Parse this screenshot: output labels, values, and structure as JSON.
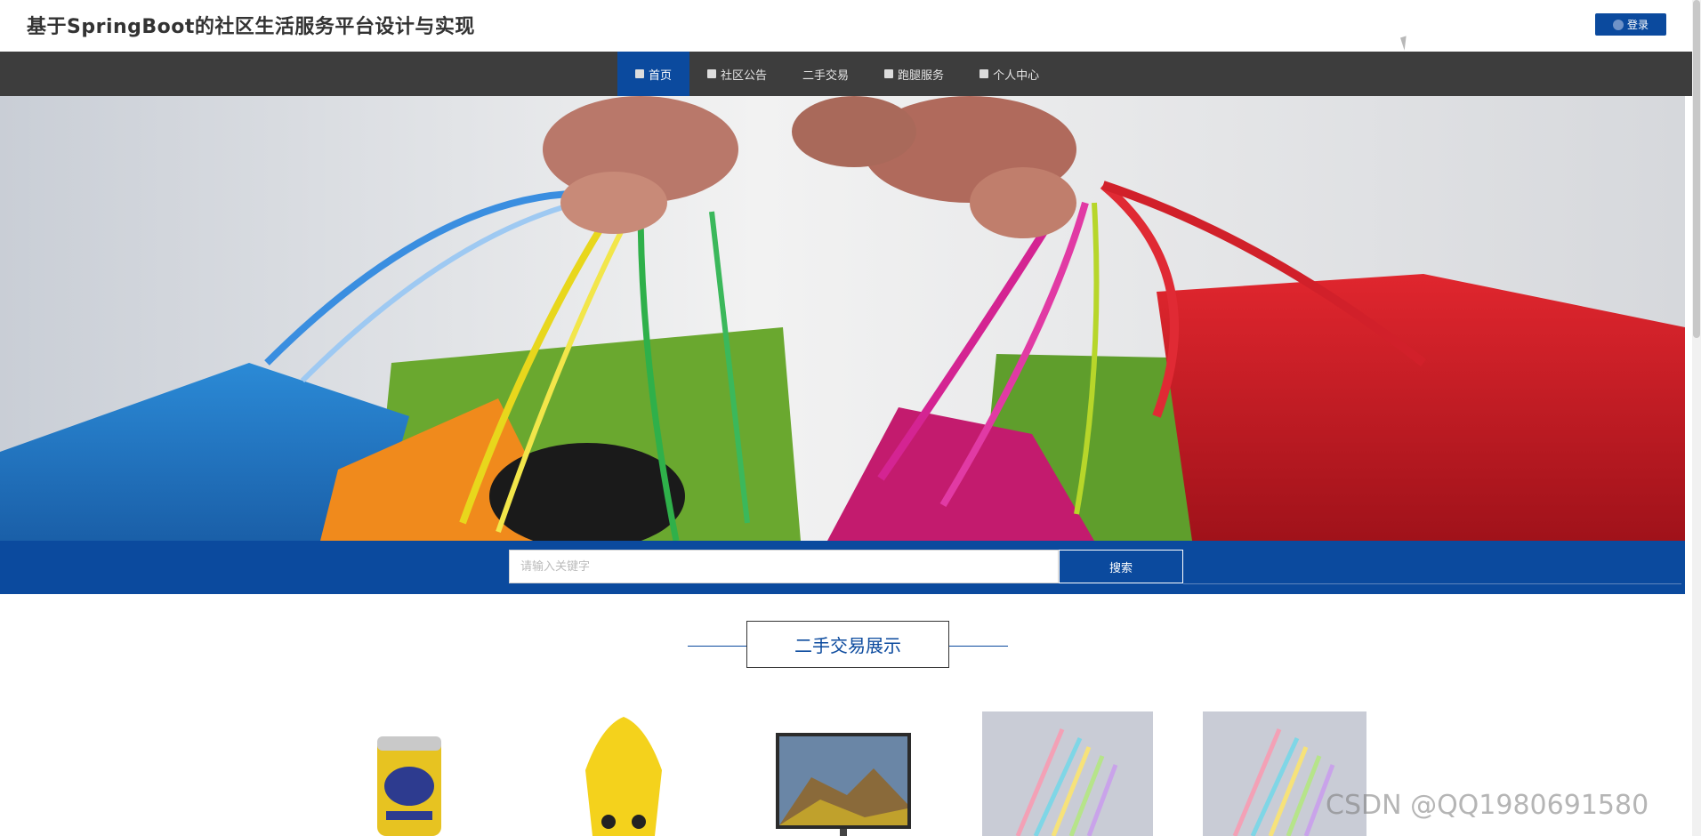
{
  "header": {
    "title": "基于SpringBoot的社区生活服务平台设计与实现",
    "login_label": "登录"
  },
  "nav": {
    "items": [
      {
        "label": "首页",
        "icon": "home-icon",
        "active": true
      },
      {
        "label": "社区公告",
        "icon": "notice-icon",
        "active": false
      },
      {
        "label": "二手交易",
        "icon": "trade-icon",
        "active": false
      },
      {
        "label": "跑腿服务",
        "icon": "errand-icon",
        "active": false
      },
      {
        "label": "个人中心",
        "icon": "user-icon",
        "active": false
      }
    ]
  },
  "search": {
    "placeholder": "请输入关键字",
    "button_label": "搜索"
  },
  "section": {
    "title": "二手交易展示"
  },
  "products": [
    {
      "name": "drink-can"
    },
    {
      "name": "yellow-plush-toy"
    },
    {
      "name": "landscape-monitor"
    },
    {
      "name": "colored-pens"
    },
    {
      "name": "colored-pens"
    }
  ],
  "watermark": "CSDN @QQ1980691580",
  "colors": {
    "brand_blue": "#0b4a9e",
    "nav_dark": "#3d3d3d"
  }
}
